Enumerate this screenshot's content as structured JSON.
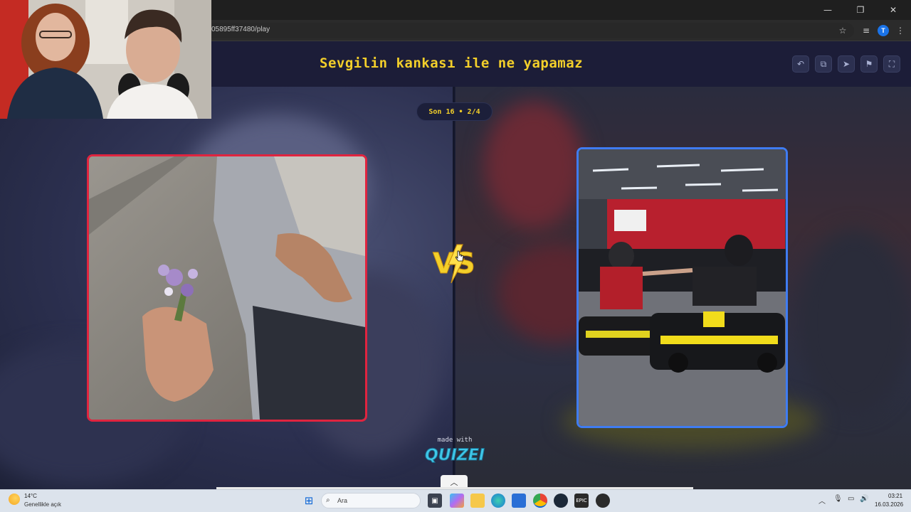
{
  "browser": {
    "url": "05895ff37480/play",
    "profile_initial": "T"
  },
  "quiz": {
    "title": "Sevgilin kankası ile ne yapamaz",
    "round_label": "Son 16 • 2/4",
    "left_choice_image": "man kneeling offering purple flowers",
    "right_choice_image": "two go-kart drivers fist bumping",
    "vs_label": "VS",
    "branding_made_with": "made with",
    "branding_logo": "QUIZEI",
    "header_buttons": [
      "undo-icon",
      "copy-icon",
      "send-icon",
      "flag-icon",
      "fullscreen-icon"
    ]
  },
  "taskbar": {
    "weather_temp": "14°C",
    "weather_desc": "Genellikle açık",
    "search_placeholder": "Ara",
    "clock_time": "03:21",
    "clock_date": "16.03.2026"
  },
  "colors": {
    "accent_yellow": "#f3cf2a",
    "left_border": "#e0243f",
    "right_border": "#3f7cf2",
    "page_bg": "#1c1f36"
  }
}
